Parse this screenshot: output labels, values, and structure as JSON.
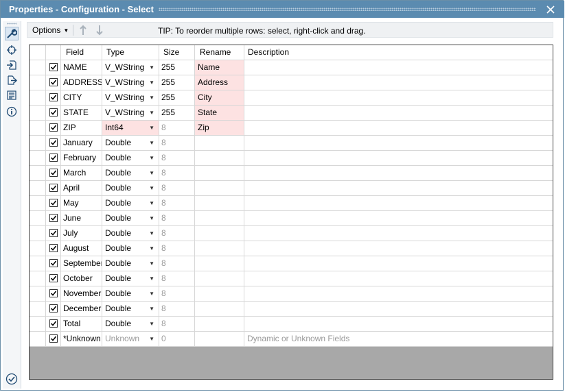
{
  "window": {
    "title": "Properties - Configuration - Select"
  },
  "toolbar": {
    "options_label": "Options",
    "tip": "TIP: To reorder multiple rows: select, right-click and drag."
  },
  "columns": {
    "field": "Field",
    "type": "Type",
    "size": "Size",
    "rename": "Rename",
    "description": "Description"
  },
  "rows": [
    {
      "checked": true,
      "field": "NAME",
      "type": "V_WString",
      "size": "255",
      "rename": "Name",
      "description": "",
      "type_changed": false,
      "size_gray": false,
      "type_gray": false
    },
    {
      "checked": true,
      "field": "ADDRESS",
      "type": "V_WString",
      "size": "255",
      "rename": "Address",
      "description": "",
      "type_changed": false,
      "size_gray": false,
      "type_gray": false
    },
    {
      "checked": true,
      "field": "CITY",
      "type": "V_WString",
      "size": "255",
      "rename": "City",
      "description": "",
      "type_changed": false,
      "size_gray": false,
      "type_gray": false
    },
    {
      "checked": true,
      "field": "STATE",
      "type": "V_WString",
      "size": "255",
      "rename": "State",
      "description": "",
      "type_changed": false,
      "size_gray": false,
      "type_gray": false
    },
    {
      "checked": true,
      "field": "ZIP",
      "type": "Int64",
      "size": "8",
      "rename": "Zip",
      "description": "",
      "type_changed": true,
      "size_gray": true,
      "type_gray": false
    },
    {
      "checked": true,
      "field": "January",
      "type": "Double",
      "size": "8",
      "rename": "",
      "description": "",
      "type_changed": false,
      "size_gray": true,
      "type_gray": false
    },
    {
      "checked": true,
      "field": "February",
      "type": "Double",
      "size": "8",
      "rename": "",
      "description": "",
      "type_changed": false,
      "size_gray": true,
      "type_gray": false
    },
    {
      "checked": true,
      "field": "March",
      "type": "Double",
      "size": "8",
      "rename": "",
      "description": "",
      "type_changed": false,
      "size_gray": true,
      "type_gray": false
    },
    {
      "checked": true,
      "field": "April",
      "type": "Double",
      "size": "8",
      "rename": "",
      "description": "",
      "type_changed": false,
      "size_gray": true,
      "type_gray": false
    },
    {
      "checked": true,
      "field": "May",
      "type": "Double",
      "size": "8",
      "rename": "",
      "description": "",
      "type_changed": false,
      "size_gray": true,
      "type_gray": false
    },
    {
      "checked": true,
      "field": "June",
      "type": "Double",
      "size": "8",
      "rename": "",
      "description": "",
      "type_changed": false,
      "size_gray": true,
      "type_gray": false
    },
    {
      "checked": true,
      "field": "July",
      "type": "Double",
      "size": "8",
      "rename": "",
      "description": "",
      "type_changed": false,
      "size_gray": true,
      "type_gray": false
    },
    {
      "checked": true,
      "field": "August",
      "type": "Double",
      "size": "8",
      "rename": "",
      "description": "",
      "type_changed": false,
      "size_gray": true,
      "type_gray": false
    },
    {
      "checked": true,
      "field": "September",
      "type": "Double",
      "size": "8",
      "rename": "",
      "description": "",
      "type_changed": false,
      "size_gray": true,
      "type_gray": false
    },
    {
      "checked": true,
      "field": "October",
      "type": "Double",
      "size": "8",
      "rename": "",
      "description": "",
      "type_changed": false,
      "size_gray": true,
      "type_gray": false
    },
    {
      "checked": true,
      "field": "November",
      "type": "Double",
      "size": "8",
      "rename": "",
      "description": "",
      "type_changed": false,
      "size_gray": true,
      "type_gray": false
    },
    {
      "checked": true,
      "field": "December",
      "type": "Double",
      "size": "8",
      "rename": "",
      "description": "",
      "type_changed": false,
      "size_gray": true,
      "type_gray": false
    },
    {
      "checked": true,
      "field": "Total",
      "type": "Double",
      "size": "8",
      "rename": "",
      "description": "",
      "type_changed": false,
      "size_gray": true,
      "type_gray": false
    },
    {
      "checked": true,
      "field": "*Unknown",
      "type": "Unknown",
      "size": "0",
      "rename": "",
      "description": "Dynamic or Unknown Fields",
      "type_changed": false,
      "size_gray": true,
      "type_gray": true
    }
  ],
  "icons": {
    "rail": [
      "wrench-icon",
      "crosshair-icon",
      "input-anchor-icon",
      "output-anchor-icon",
      "document-icon",
      "info-icon",
      "checkmark-circle-icon"
    ],
    "toolbar": [
      "caret-down-icon",
      "arrow-up-icon",
      "arrow-down-icon"
    ],
    "titlebar": [
      "close-icon"
    ]
  },
  "colors": {
    "title_bar": "#5b8bb0",
    "changed_cell": "#fde2e2",
    "empty_grid": "#a8a8a8"
  }
}
